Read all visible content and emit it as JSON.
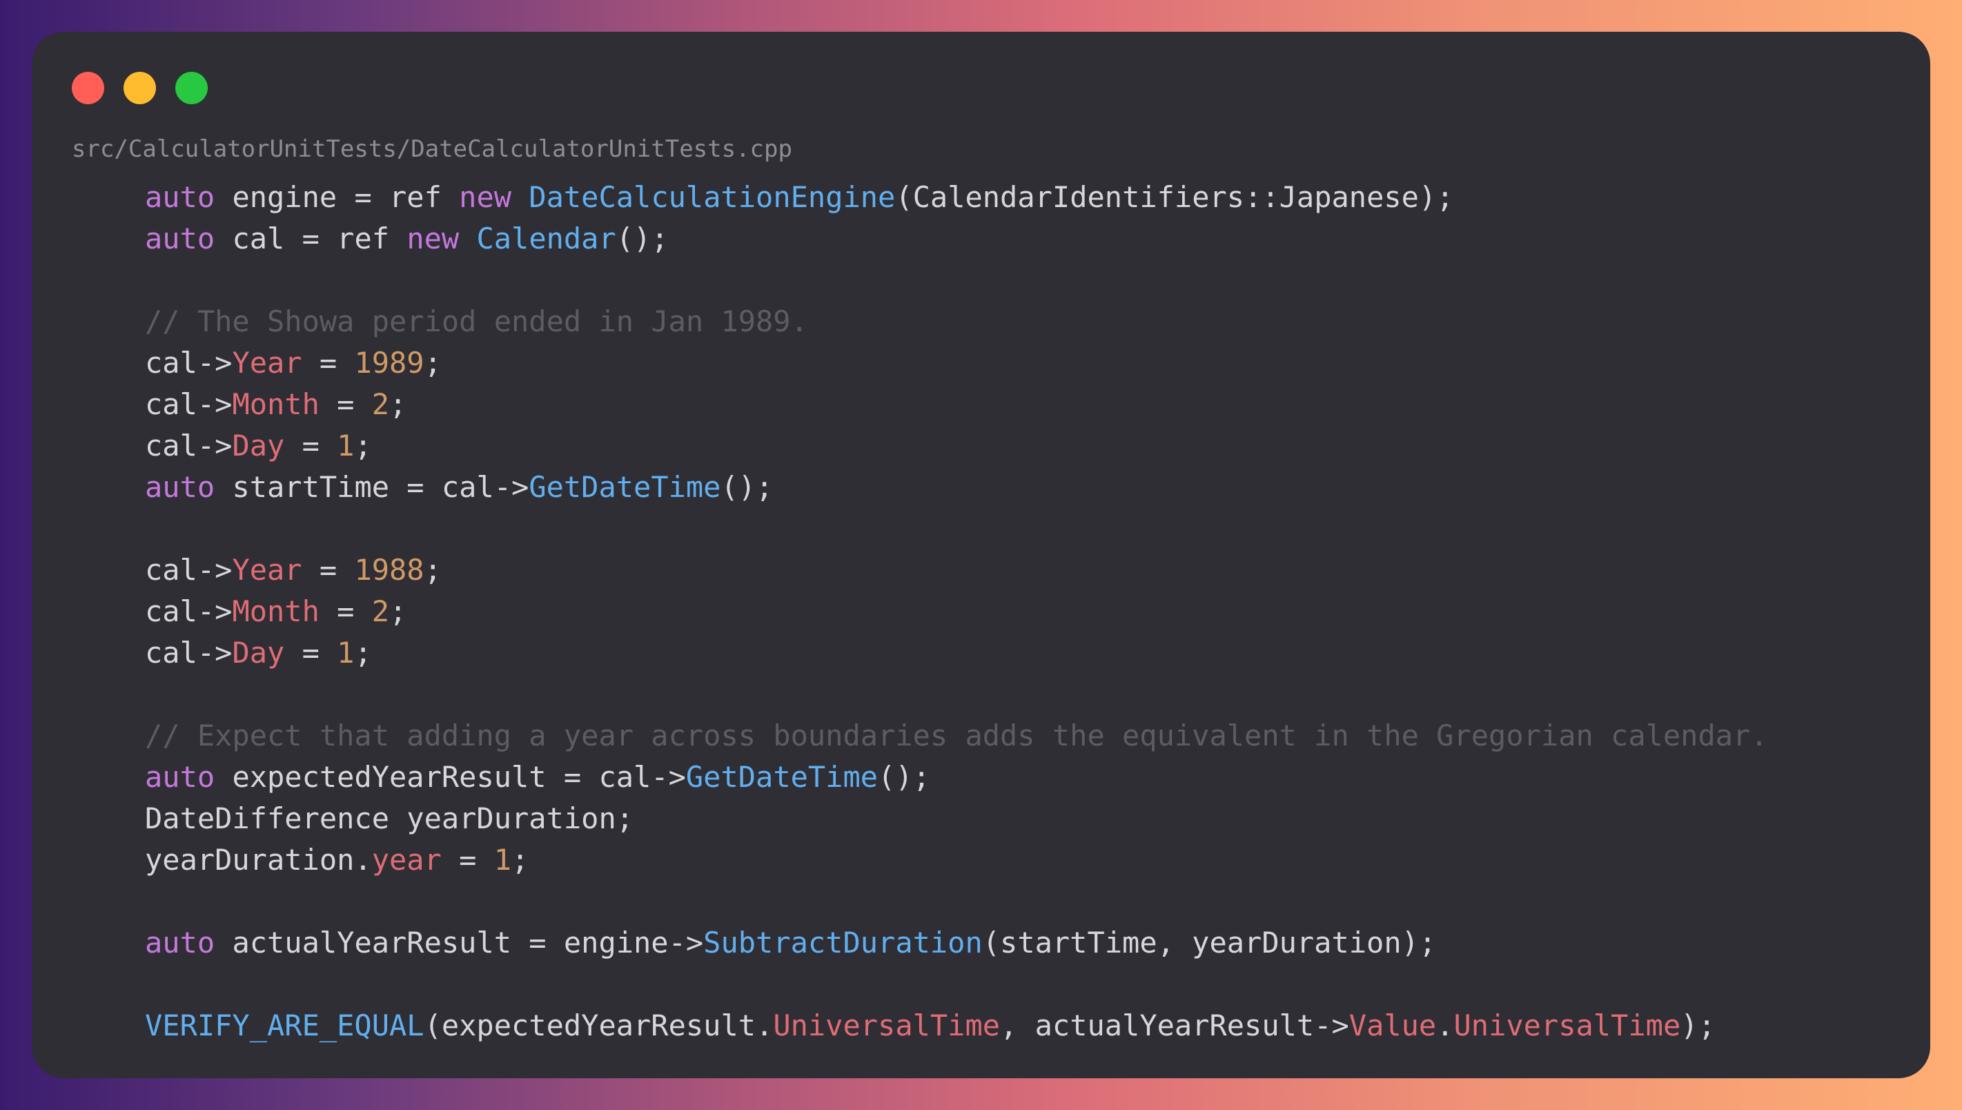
{
  "window": {
    "controls": [
      {
        "name": "close",
        "color": "#ff5f57"
      },
      {
        "name": "minimize",
        "color": "#febc2e"
      },
      {
        "name": "zoom",
        "color": "#28c840"
      }
    ],
    "filename": "src/CalculatorUnitTests/DateCalculatorUnitTests.cpp"
  },
  "colors": {
    "keyword": "#c678dd",
    "function": "#61afef",
    "property": "#e06c75",
    "number": "#d19a66",
    "comment": "#5c5c66",
    "text": "#d6d6db",
    "background": "#2f2e35"
  },
  "code": {
    "lines": [
      [
        [
          "kw",
          "auto"
        ],
        [
          "p",
          " engine = ref "
        ],
        [
          "kw",
          "new"
        ],
        [
          "p",
          " "
        ],
        [
          "fn",
          "DateCalculationEngine"
        ],
        [
          "p",
          "(CalendarIdentifiers::Japanese);"
        ]
      ],
      [
        [
          "kw",
          "auto"
        ],
        [
          "p",
          " cal = ref "
        ],
        [
          "kw",
          "new"
        ],
        [
          "p",
          " "
        ],
        [
          "fn",
          "Calendar"
        ],
        [
          "p",
          "();"
        ]
      ],
      [],
      [
        [
          "cmt",
          "// The Showa period ended in Jan 1989."
        ]
      ],
      [
        [
          "p",
          "cal->"
        ],
        [
          "prop",
          "Year"
        ],
        [
          "p",
          " = "
        ],
        [
          "num",
          "1989"
        ],
        [
          "p",
          ";"
        ]
      ],
      [
        [
          "p",
          "cal->"
        ],
        [
          "prop",
          "Month"
        ],
        [
          "p",
          " = "
        ],
        [
          "num",
          "2"
        ],
        [
          "p",
          ";"
        ]
      ],
      [
        [
          "p",
          "cal->"
        ],
        [
          "prop",
          "Day"
        ],
        [
          "p",
          " = "
        ],
        [
          "num",
          "1"
        ],
        [
          "p",
          ";"
        ]
      ],
      [
        [
          "kw",
          "auto"
        ],
        [
          "p",
          " startTime = cal->"
        ],
        [
          "fn",
          "GetDateTime"
        ],
        [
          "p",
          "();"
        ]
      ],
      [],
      [
        [
          "p",
          "cal->"
        ],
        [
          "prop",
          "Year"
        ],
        [
          "p",
          " = "
        ],
        [
          "num",
          "1988"
        ],
        [
          "p",
          ";"
        ]
      ],
      [
        [
          "p",
          "cal->"
        ],
        [
          "prop",
          "Month"
        ],
        [
          "p",
          " = "
        ],
        [
          "num",
          "2"
        ],
        [
          "p",
          ";"
        ]
      ],
      [
        [
          "p",
          "cal->"
        ],
        [
          "prop",
          "Day"
        ],
        [
          "p",
          " = "
        ],
        [
          "num",
          "1"
        ],
        [
          "p",
          ";"
        ]
      ],
      [],
      [
        [
          "cmt",
          "// Expect that adding a year across boundaries adds the equivalent in the Gregorian calendar."
        ]
      ],
      [
        [
          "kw",
          "auto"
        ],
        [
          "p",
          " expectedYearResult = cal->"
        ],
        [
          "fn",
          "GetDateTime"
        ],
        [
          "p",
          "();"
        ]
      ],
      [
        [
          "p",
          "DateDifference yearDuration;"
        ]
      ],
      [
        [
          "p",
          "yearDuration."
        ],
        [
          "prop",
          "year"
        ],
        [
          "p",
          " = "
        ],
        [
          "num",
          "1"
        ],
        [
          "p",
          ";"
        ]
      ],
      [],
      [
        [
          "kw",
          "auto"
        ],
        [
          "p",
          " actualYearResult = engine->"
        ],
        [
          "fn",
          "SubtractDuration"
        ],
        [
          "p",
          "(startTime, yearDuration);"
        ]
      ],
      [],
      [
        [
          "fn",
          "VERIFY_ARE_EQUAL"
        ],
        [
          "p",
          "(expectedYearResult."
        ],
        [
          "prop",
          "UniversalTime"
        ],
        [
          "p",
          ", actualYearResult->"
        ],
        [
          "prop",
          "Value"
        ],
        [
          "p",
          "."
        ],
        [
          "prop",
          "UniversalTime"
        ],
        [
          "p",
          ");"
        ]
      ]
    ]
  }
}
